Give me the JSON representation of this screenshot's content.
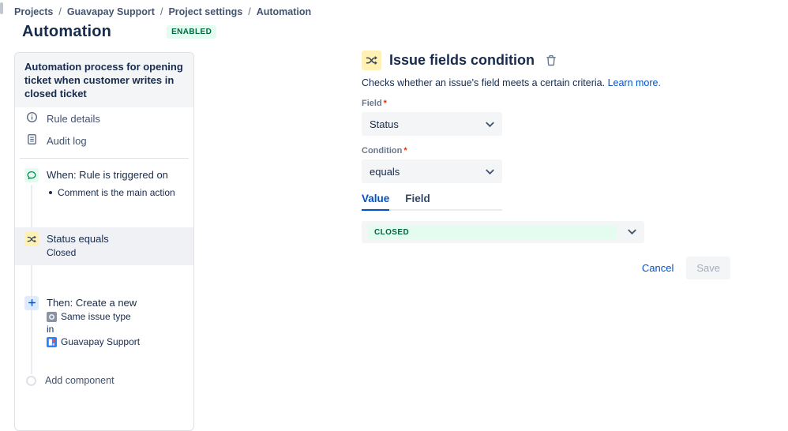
{
  "breadcrumb": {
    "items": [
      "Projects",
      "Guavapay Support",
      "Project settings",
      "Automation"
    ],
    "separator": "/"
  },
  "header": {
    "title": "Automation",
    "status_badge": "ENABLED"
  },
  "sidebar": {
    "rule_title": "Automation process for opening ticket when customer writes in closed ticket",
    "nav_items": [
      {
        "icon": "info-icon",
        "label": "Rule details"
      },
      {
        "icon": "audit-log-icon",
        "label": "Audit log"
      }
    ],
    "steps": {
      "when": {
        "icon": "comment-icon",
        "title": "When: Rule is triggered on",
        "detail": "Comment is the main action"
      },
      "condition": {
        "icon": "shuffle-icon",
        "title": "Status equals",
        "detail": "Closed"
      },
      "then": {
        "icon": "plus-icon",
        "title": "Then: Create a new",
        "issue_type": "Same issue type",
        "connector": "in",
        "project": "Guavapay Support"
      },
      "add_component": {
        "icon": "circle-outline-icon",
        "label": "Add component"
      }
    }
  },
  "panel": {
    "icon": "shuffle-icon",
    "title": "Issue fields condition",
    "delete_icon": "trash-icon",
    "description": "Checks whether an issue's field meets a certain criteria.",
    "learn_more": "Learn more.",
    "field": {
      "label": "Field",
      "required": "*",
      "value": "Status"
    },
    "condition": {
      "label": "Condition",
      "required": "*",
      "value": "equals"
    },
    "tabs": [
      {
        "label": "Value",
        "active": true
      },
      {
        "label": "Field",
        "active": false
      }
    ],
    "value_select": {
      "value": "CLOSED"
    },
    "actions": {
      "cancel": "Cancel",
      "save": "Save"
    }
  },
  "colors": {
    "brand_blue": "#0052cc",
    "text_dark": "#172b4d",
    "green_badge_bg": "#e3fcef",
    "green_badge_text": "#006644",
    "yellow_icon_bg": "#fff0b3",
    "blue_icon_bg": "#deebff",
    "field_bg": "#f4f5f7",
    "border": "#dfe1e6"
  }
}
